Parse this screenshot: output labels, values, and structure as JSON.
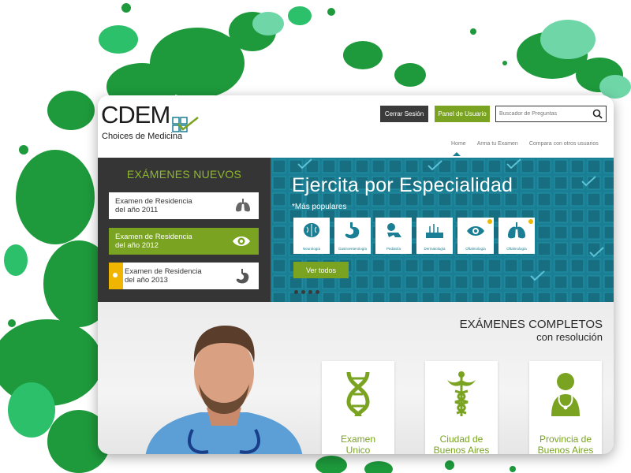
{
  "colors": {
    "brand_green": "#79a320",
    "teal": "#1a7f94",
    "dark": "#353535",
    "accent_yellow": "#f0b500"
  },
  "header": {
    "logo": {
      "main": "CDEM",
      "sub": "Choices de Medicina",
      "icon": "grid-check-logo"
    },
    "logout_label": "Cerrar Sesión",
    "panel_label": "Panel de Usuario",
    "search_placeholder": "Buscador de Preguntas",
    "nav": [
      "Home",
      "Arma tu Examen",
      "Compara con otros usuarios"
    ]
  },
  "left_panel": {
    "title": "EXÁMENES NUEVOS",
    "exams": [
      {
        "line1": "Examen de Residencia",
        "line2": "del año 2011",
        "icon": "lungs-icon"
      },
      {
        "line1": "Examen de Residencia",
        "line2": "del año 2012",
        "icon": "eye-icon"
      },
      {
        "line1": "Examen de Residencia",
        "line2": "del año 2013",
        "icon": "stomach-icon"
      }
    ]
  },
  "right_panel": {
    "title": "Ejercita por Especialidad",
    "subtitle": "*Más populares",
    "specialties": [
      {
        "label": "Neurología",
        "icon": "brain-icon"
      },
      {
        "label": "Gastroenterología",
        "icon": "stomach-icon"
      },
      {
        "label": "Pediatría",
        "icon": "baby-icon"
      },
      {
        "label": "Dermatología",
        "icon": "skin-icon"
      },
      {
        "label": "Oftalmología",
        "icon": "eye-icon"
      },
      {
        "label": "Oftalmología",
        "icon": "lungs-icon"
      }
    ],
    "button_label": "Ver todos"
  },
  "lower": {
    "title": "EXÁMENES COMPLETOS",
    "subtitle": "con resolución",
    "cards": [
      {
        "line1": "Examen",
        "line2": "Unico",
        "icon": "dna-icon"
      },
      {
        "line1": "Ciudad de",
        "line2": "Buenos Aires",
        "icon": "caduceus-icon"
      },
      {
        "line1": "Provincia de",
        "line2": "Buenos Aires",
        "icon": "doctor-icon"
      }
    ]
  }
}
